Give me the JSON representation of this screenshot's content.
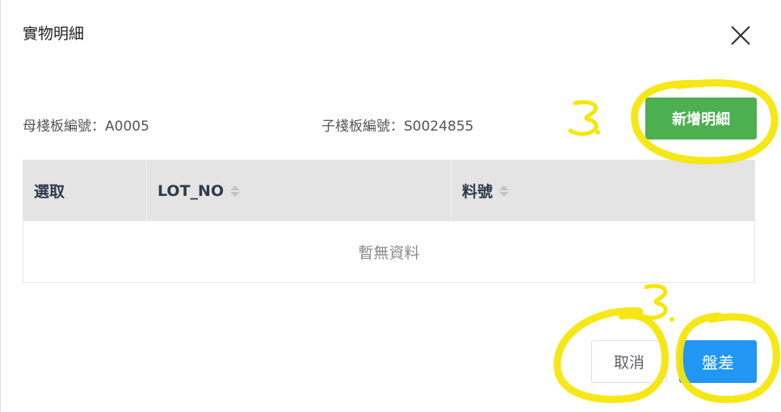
{
  "modal": {
    "title": "實物明細",
    "parent_board_label": "母棧板編號：",
    "parent_board_value": "A0005",
    "child_board_label": "子棧板編號：",
    "child_board_value": "S0024855",
    "add_detail_label": "新增明細",
    "icons": {
      "close": "close-icon",
      "sort": "sort-icon"
    }
  },
  "table": {
    "columns": [
      "選取",
      "LOT_NO",
      "料號"
    ],
    "empty_text": "暫無資料"
  },
  "footer": {
    "cancel_label": "取消",
    "inventory_diff_label": "盤差"
  },
  "annotations": {
    "marker_label_top": "3.",
    "marker_label_bottom": "3.",
    "highlight_color": "#f5e60a"
  },
  "colors": {
    "add_button": "#4caf50",
    "primary_button": "#2196f3",
    "table_header_bg": "#e4e4e4"
  }
}
